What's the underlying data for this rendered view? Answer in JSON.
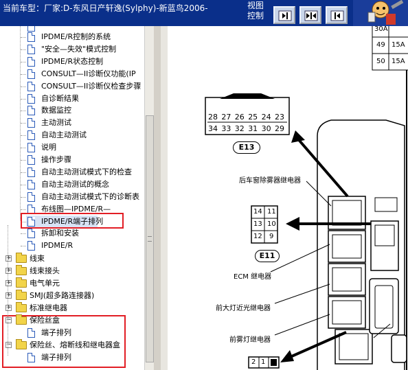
{
  "window": {
    "title": "当前车型：厂家:D-东风日产轩逸(Sylphy)-新蓝鸟2006-",
    "view_control": "视图\n控制"
  },
  "tree": {
    "items": [
      {
        "label": "IPDME/R控制的系统"
      },
      {
        "label": "\"安全—失效\"模式控制"
      },
      {
        "label": "IPDME/R状态控制"
      },
      {
        "label": "CONSULT—II诊断仪功能(IP"
      },
      {
        "label": "CONSULT—II诊断仪检查步骤"
      },
      {
        "label": "自诊断结果"
      },
      {
        "label": "数据监控"
      },
      {
        "label": "主动测试"
      },
      {
        "label": "自动主动测试"
      },
      {
        "label": "说明"
      },
      {
        "label": "操作步骤"
      },
      {
        "label": "自动主动测试模式下的检查"
      },
      {
        "label": "自动主动测试的概念"
      },
      {
        "label": "自动主动测试模式下的诊断表"
      },
      {
        "label": "布线图—IPDME/R—"
      },
      {
        "label": "IPDME/R端子排列"
      },
      {
        "label": "拆卸和安装"
      },
      {
        "label": "IPDME/R"
      }
    ],
    "folders": [
      {
        "label": "线束"
      },
      {
        "label": "线束接头"
      },
      {
        "label": "电气单元"
      },
      {
        "label": "SMJ(超多路连接器)"
      },
      {
        "label": "标准继电器"
      },
      {
        "label": "保险丝盒"
      },
      {
        "label": "端子排列"
      },
      {
        "label": "保险丝、熔断线和继电器盒"
      },
      {
        "label": "端子排列"
      }
    ]
  },
  "diagram": {
    "connector_top_row": [
      "28",
      "27",
      "26",
      "25",
      "24",
      "23"
    ],
    "connector_bottom_row": [
      "34",
      "33",
      "32",
      "31",
      "30",
      "29"
    ],
    "connector_e13": "E13",
    "connector_e11": "E11",
    "e11_rows": [
      [
        "14",
        "11"
      ],
      [
        "13",
        "10"
      ],
      [
        "12",
        "9"
      ]
    ],
    "bottom_connector": [
      "2",
      "1"
    ],
    "fuse_table": [
      [
        "49",
        "15A"
      ],
      [
        "50",
        "15A"
      ]
    ],
    "fuse_table_partial": "30A",
    "labels": {
      "rear_defogger_relay": "后车窗除雾器继电器",
      "ecm_relay": "ECM 继电器",
      "headlamp_low_relay": "前大灯近光继电器",
      "front_fog_relay": "前雾灯继电器"
    }
  }
}
